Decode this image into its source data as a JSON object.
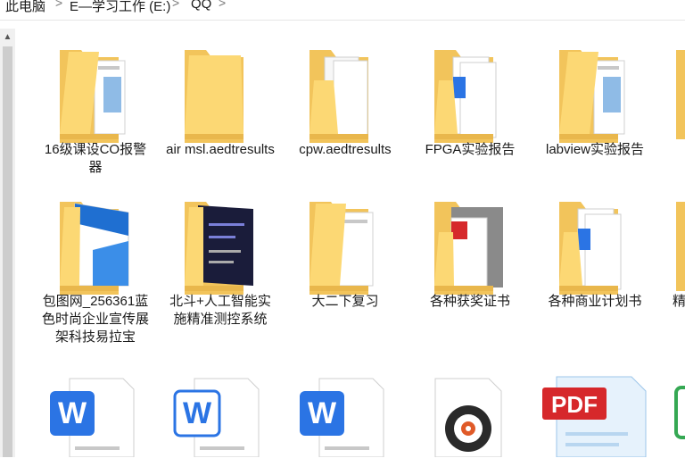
{
  "breadcrumb": {
    "items": [
      "此电脑",
      "E—学习工作 (E:)",
      "QQ"
    ],
    "separator": ">"
  },
  "scrollbar": {
    "up_glyph": "▲"
  },
  "items": [
    {
      "label": "16级课设CO报警器",
      "icon": "folder-docs-icon"
    },
    {
      "label": "air msl.aedtresults",
      "icon": "folder-icon"
    },
    {
      "label": "cpw.aedtresults",
      "icon": "folder-papers-icon"
    },
    {
      "label": "FPGA实验报告",
      "icon": "folder-word-icon"
    },
    {
      "label": "labview实验报告",
      "icon": "folder-docs-icon"
    },
    {
      "label": "包图网_256361蓝色时尚企业宣传展架科技易拉宝",
      "icon": "folder-brochure-icon"
    },
    {
      "label": "北斗+人工智能实施精准测控系统",
      "icon": "folder-dark-poster-icon"
    },
    {
      "label": "大二下复习",
      "icon": "folder-docs-icon"
    },
    {
      "label": "各种获奖证书",
      "icon": "folder-pdf-photo-icon"
    },
    {
      "label": "各种商业计划书",
      "icon": "folder-word-icon"
    },
    {
      "label": "精",
      "icon": "folder-icon"
    },
    {
      "label": "",
      "icon": "word-file-icon"
    },
    {
      "label": "",
      "icon": "word-file-icon"
    },
    {
      "label": "",
      "icon": "word-file-icon"
    },
    {
      "label": "",
      "icon": "media-file-icon"
    },
    {
      "label": "",
      "icon": "pdf-file-icon"
    }
  ],
  "colors": {
    "folder_back": "#f2c45b",
    "folder_front": "#fcd874",
    "word_blue": "#2b74e4",
    "pdf_red": "#d6282b"
  },
  "badges": {
    "word_glyph": "W",
    "pdf_text": "PDF"
  }
}
